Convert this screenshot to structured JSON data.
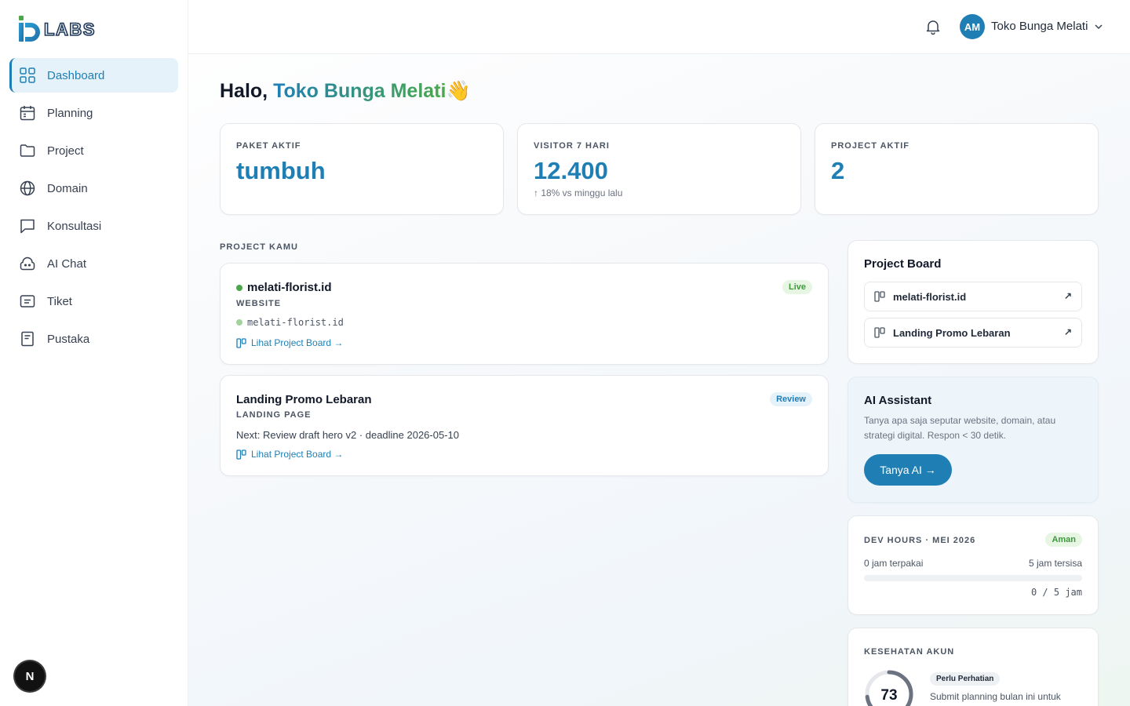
{
  "brand": {
    "logo_text": "LABS",
    "primary_color": "#1f7fb5",
    "accent_color": "#4aa84a"
  },
  "sidebar": {
    "items": [
      {
        "label": "Dashboard",
        "icon": "grid-icon",
        "active": true
      },
      {
        "label": "Planning",
        "icon": "calendar-icon"
      },
      {
        "label": "Project",
        "icon": "folder-icon"
      },
      {
        "label": "Domain",
        "icon": "globe-icon"
      },
      {
        "label": "Konsultasi",
        "icon": "chat-icon"
      },
      {
        "label": "AI Chat",
        "icon": "bot-icon"
      },
      {
        "label": "Tiket",
        "icon": "ticket-icon"
      },
      {
        "label": "Pustaka",
        "icon": "book-icon"
      }
    ],
    "next_badge": "N"
  },
  "header": {
    "avatar_initials": "AM",
    "user_name": "Toko Bunga Melati"
  },
  "greeting": {
    "prefix": "Halo, ",
    "name": "Toko Bunga Melati",
    "emoji": "👋"
  },
  "stats": [
    {
      "label": "PAKET AKTIF",
      "value": "tumbuh",
      "sub": ""
    },
    {
      "label": "VISITOR 7 HARI",
      "value": "12.400",
      "sub": "↑ 18% vs minggu lalu"
    },
    {
      "label": "PROJECT AKTIF",
      "value": "2",
      "sub": ""
    }
  ],
  "projects_section": {
    "label": "PROJECT KAMU",
    "projects": [
      {
        "title": "melati-florist.id",
        "type": "WEBSITE",
        "url": "melati-florist.id",
        "status": "Live",
        "link": "Lihat Project Board →"
      },
      {
        "title": "Landing Promo Lebaran",
        "type": "LANDING PAGE",
        "next": "Next: Review draft hero v2 · deadline 2026-05-10",
        "status": "Review",
        "link": "Lihat Project Board →"
      }
    ]
  },
  "project_board": {
    "title": "Project Board",
    "items": [
      "melati-florist.id",
      "Landing Promo Lebaran"
    ],
    "arrow": "↗"
  },
  "ai_assistant": {
    "title": "AI Assistant",
    "description": "Tanya apa saja seputar website, domain, atau strategi digital. Respon < 30 detik.",
    "button": "Tanya AI →"
  },
  "dev_hours": {
    "label": "DEV HOURS · MEI 2026",
    "badge": "Aman",
    "used_text": "0 jam terpakai",
    "left_text": "5 jam tersisa",
    "used_fraction": 0,
    "summary": "0 / 5 jam"
  },
  "account_health": {
    "label": "KESEHATAN AKUN",
    "score": "73",
    "score_value": 73,
    "badge": "Perlu Perhatian",
    "text": "Submit planning bulan ini untuk"
  }
}
